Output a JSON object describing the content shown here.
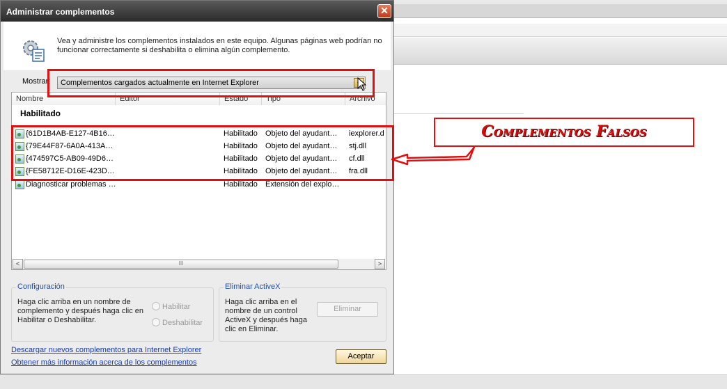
{
  "dialog": {
    "title": "Administrar complementos",
    "close_glyph": "✕",
    "description": "Vea y administre los complementos instalados en este equipo. Algunas páginas web podrían no funcionar correctamente si deshabilita o elimina algún complemento.",
    "show_label": "Mostrar:",
    "show_value": "Complementos cargados actualmente en Internet Explorer"
  },
  "list": {
    "columns": [
      "Nombre",
      "Editor",
      "Estado",
      "Tipo",
      "Archivo"
    ],
    "group_label": "Habilitado",
    "rows": [
      {
        "name": "{61D1B4AB-E127-4B16…",
        "status": "Habilitado",
        "type": "Objeto del ayudant…",
        "file": "iexplorer.d"
      },
      {
        "name": "{79E44F87-6A0A-413A…",
        "status": "Habilitado",
        "type": "Objeto del ayudant…",
        "file": "stj.dll"
      },
      {
        "name": "{474597C5-AB09-49D6…",
        "status": "Habilitado",
        "type": "Objeto del ayudant…",
        "file": "cf.dll"
      },
      {
        "name": "{FE58712E-D16E-423D…",
        "status": "Habilitado",
        "type": "Objeto del ayudant…",
        "file": "fra.dll"
      },
      {
        "name": "Diagnosticar problemas …",
        "status": "Habilitado",
        "type": "Extensión del explo…",
        "file": ""
      }
    ],
    "scroll_left": "<",
    "scroll_right": ">",
    "scroll_grip": "III"
  },
  "config": {
    "title": "Configuración",
    "text": "Haga clic arriba en un nombre de complemento y después haga clic en Habilitar o Deshabilitar.",
    "enable_label": "Habilitar",
    "disable_label": "Deshabilitar"
  },
  "activex": {
    "title": "Eliminar ActiveX",
    "text": "Haga clic arriba en el nombre de un control ActiveX y después haga clic en Eliminar.",
    "remove_label": "Eliminar"
  },
  "links": {
    "download": "Descargar nuevos complementos para Internet Explorer",
    "more_info": "Obtener más información acerca de los complementos"
  },
  "accept_label": "Aceptar",
  "annotation": {
    "text": "Complementos Falsos",
    "color": "#e01010"
  }
}
